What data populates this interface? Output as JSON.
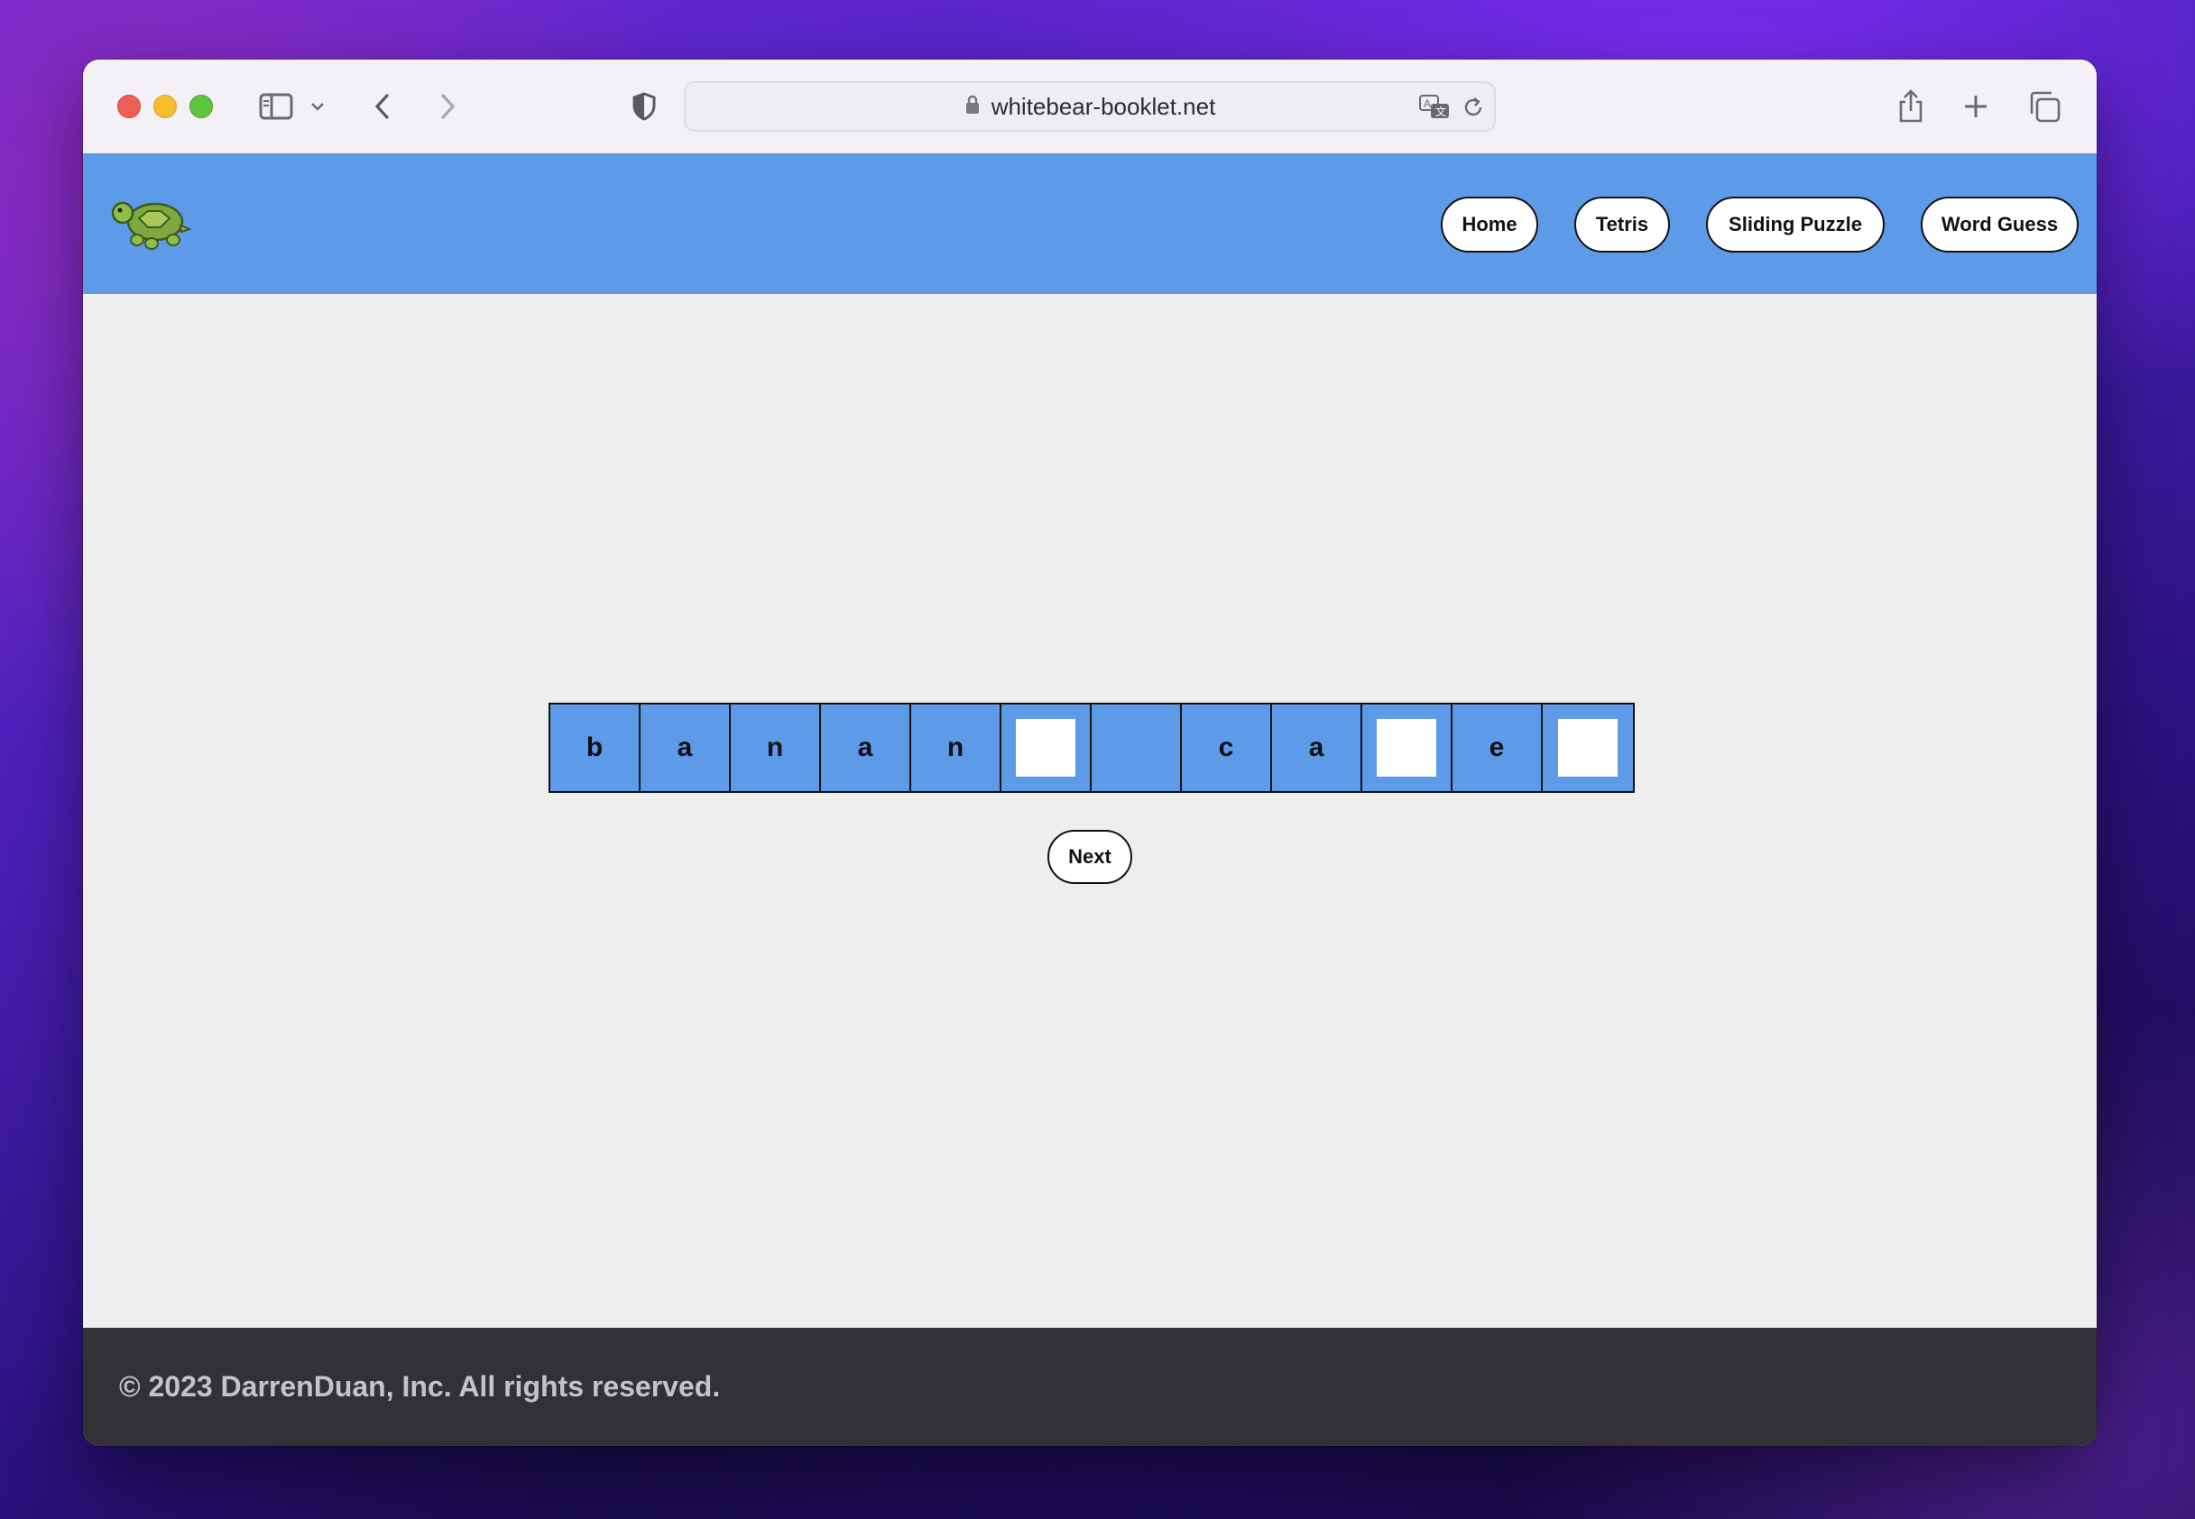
{
  "browser": {
    "url": "whitebear-booklet.net",
    "icons": {
      "sidebar": "sidebar-icon",
      "sidebar_menu": "chevron-down-icon",
      "back": "chevron-left-icon",
      "forward": "chevron-right-icon",
      "privacy": "shield-icon",
      "lock": "lock-icon",
      "translate": "translate-icon",
      "reload": "reload-icon",
      "share": "share-icon",
      "new_tab": "plus-icon",
      "tabs": "tabs-overview-icon"
    }
  },
  "site": {
    "logo": "turtle-logo",
    "nav": {
      "home": "Home",
      "tetris": "Tetris",
      "sliding_puzzle": "Sliding Puzzle",
      "word_guess": "Word Guess"
    },
    "colors": {
      "header_bg": "#5d9be8",
      "tile_bg": "#5d9be8",
      "page_bg": "#eeeeee",
      "footer_bg": "#323236"
    }
  },
  "game": {
    "tiles": [
      {
        "letter": "b",
        "state": "revealed"
      },
      {
        "letter": "a",
        "state": "revealed"
      },
      {
        "letter": "n",
        "state": "revealed"
      },
      {
        "letter": "a",
        "state": "revealed"
      },
      {
        "letter": "n",
        "state": "revealed"
      },
      {
        "letter": "",
        "state": "blank"
      },
      {
        "letter": "",
        "state": "space"
      },
      {
        "letter": "c",
        "state": "revealed"
      },
      {
        "letter": "a",
        "state": "revealed"
      },
      {
        "letter": "",
        "state": "blank"
      },
      {
        "letter": "e",
        "state": "revealed"
      },
      {
        "letter": "",
        "state": "blank"
      }
    ],
    "next_label": "Next"
  },
  "footer": {
    "copyright": "© 2023 DarrenDuan, Inc. All rights reserved."
  }
}
